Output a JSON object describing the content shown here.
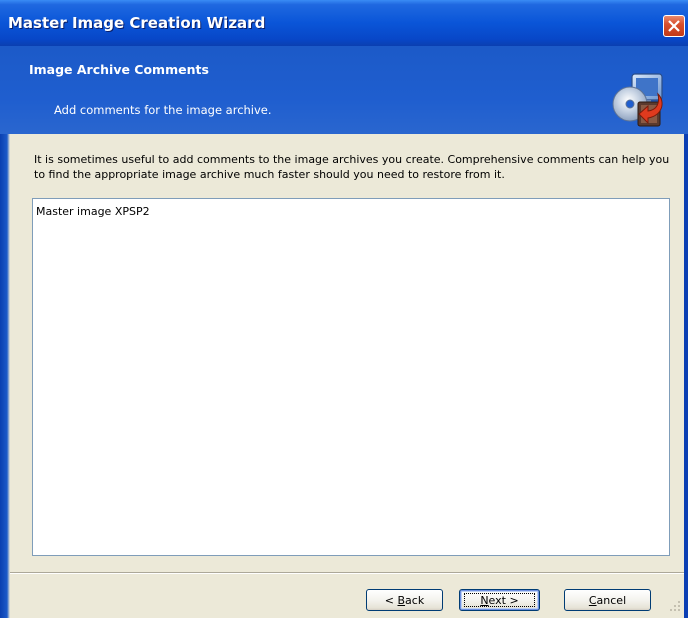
{
  "window": {
    "title": "Master Image Creation Wizard",
    "close_icon": "close-icon"
  },
  "header": {
    "title": "Image Archive Comments",
    "subtitle": "Add comments for the image archive.",
    "icon": "image-archive-icon"
  },
  "content": {
    "description": "It is sometimes useful to add comments to the image archives you create. Comprehensive comments can help you to find the appropriate image archive much faster should you need to restore from it.",
    "comment_value": "Master image XPSP2"
  },
  "buttons": {
    "back_prefix": "< ",
    "back_mnemonic": "B",
    "back_rest": "ack",
    "next_mnemonic": "N",
    "next_rest": "ext >",
    "cancel_mnemonic": "C",
    "cancel_rest": "ancel"
  },
  "colors": {
    "titlebar": "#0a55d8",
    "header": "#1f5ecf",
    "dialog_bg": "#ece9d8",
    "close_button": "#d9502e"
  }
}
